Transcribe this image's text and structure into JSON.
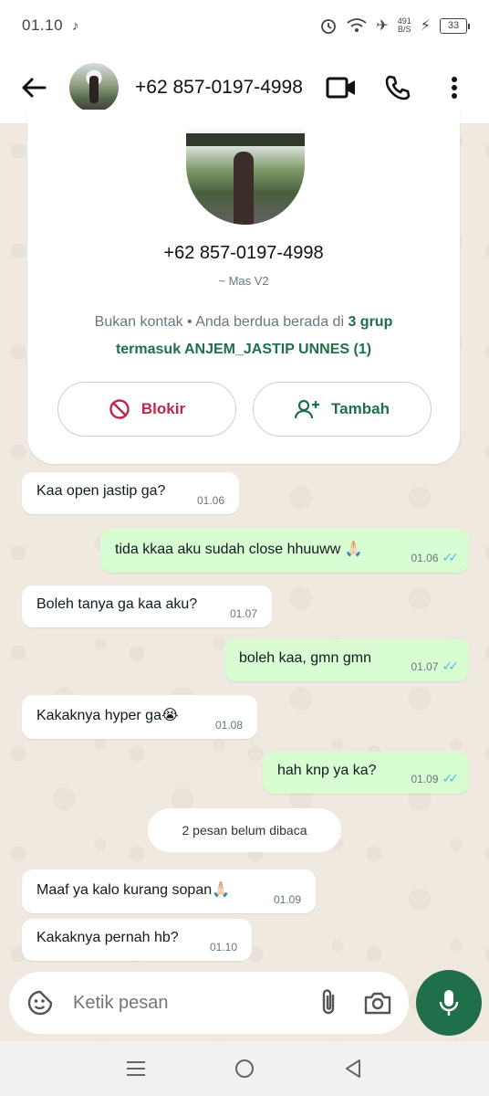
{
  "status_bar": {
    "time": "01.10",
    "speed_top": "491",
    "speed_bottom": "B/S",
    "battery": "33"
  },
  "header": {
    "contact_name": "+62 857-0197-4998"
  },
  "profile_card": {
    "number": "+62 857-0197-4998",
    "alias": "~ Mas V2",
    "info_prefix": "Bukan kontak • Anda berdua berada di ",
    "info_groups": "3 grup",
    "info_line2": "termasuk ANJEM_JASTIP UNNES (1)",
    "block_label": "Blokir",
    "add_label": "Tambah"
  },
  "messages": [
    {
      "dir": "in",
      "text": "Kaa open jastip ga?",
      "time": "01.06"
    },
    {
      "dir": "out",
      "text": "tida kkaa aku sudah close hhuuww 🙏🏻",
      "time": "01.06"
    },
    {
      "dir": "in",
      "text": "Boleh tanya ga kaa aku?",
      "time": "01.07"
    },
    {
      "dir": "out",
      "text": "boleh kaa, gmn gmn",
      "time": "01.07"
    },
    {
      "dir": "in",
      "text": "Kakaknya hyper ga😭",
      "time": "01.08"
    },
    {
      "dir": "out",
      "text": "hah knp ya ka?",
      "time": "01.09"
    },
    {
      "dir": "in",
      "text": "Maaf ya kalo kurang sopan🙏🏻",
      "time": "01.09"
    },
    {
      "dir": "in",
      "text": "Kakaknya pernah hb?",
      "time": "01.10"
    }
  ],
  "unread_label": "2 pesan belum dibaca",
  "input": {
    "placeholder": "Ketik pesan"
  },
  "colors": {
    "accent": "#1f6f4b",
    "outgoing_bubble": "#d9fdd3",
    "read_tick": "#53bdeb",
    "block_red": "#c0264a"
  }
}
